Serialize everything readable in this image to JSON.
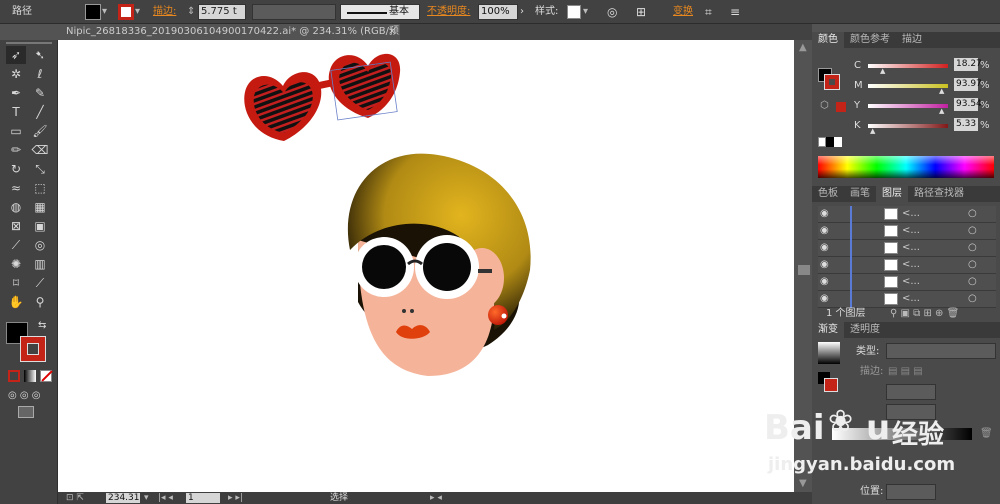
{
  "control_bar": {
    "object_type": "路径",
    "stroke_label": "描边:",
    "stroke_weight": "5.775",
    "stroke_weight_unit": "t",
    "profile": "基本",
    "opacity_label": "不透明度:",
    "opacity_value": "100%",
    "style_label": "样式:",
    "transform_label": "变换"
  },
  "document": {
    "tab_title": "Nipic_26818336_20190306104900170422.ai* @ 234.31% (RGB/预览)",
    "close_glyph": "×"
  },
  "status_bar": {
    "zoom": "234.31",
    "page": "1",
    "tool": "选择"
  },
  "color_panel": {
    "tabs": [
      "颜色",
      "颜色参考",
      "描边"
    ],
    "channels": [
      {
        "label": "C",
        "value": "18.27",
        "fraction": 0.18,
        "color": "#d02020"
      },
      {
        "label": "M",
        "value": "93.97",
        "fraction": 0.94,
        "color": "#c8c020"
      },
      {
        "label": "Y",
        "value": "93.54",
        "fraction": 0.94,
        "color": "#c020a0"
      },
      {
        "label": "K",
        "value": "5.33",
        "fraction": 0.05,
        "color": "#801818"
      }
    ],
    "fill_color": "#000000",
    "stroke_color": "#c42317"
  },
  "layers_panel": {
    "tabs": [
      "色板",
      "画笔",
      "图层",
      "路径查找器"
    ],
    "rows": [
      "<...",
      "<...",
      "<...",
      "<...",
      "<...",
      "<..."
    ],
    "footer": "1 个图层"
  },
  "gradient_panel": {
    "tabs": [
      "渐变",
      "透明度"
    ],
    "type_label": "类型:",
    "stroke_label": "描边:",
    "location_label": "位置:"
  },
  "watermark": {
    "brand": "Bai",
    "brand_end": "u",
    "brand_cn": "经验",
    "url": "jingyan.baidu.com"
  },
  "colors": {
    "accent": "#c42317",
    "hair": "#c89818",
    "skin": "#f5b49a"
  }
}
